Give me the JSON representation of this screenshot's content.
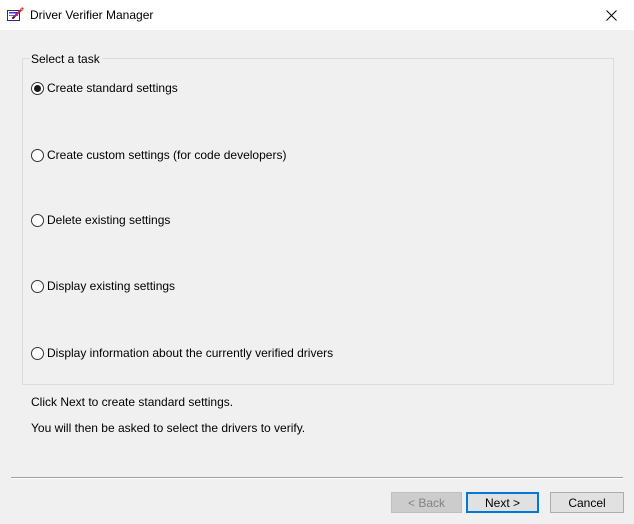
{
  "window": {
    "title": "Driver Verifier Manager",
    "app_icon": "driver-verifier-app-icon",
    "close_icon": "close-icon"
  },
  "task_group": {
    "legend": "Select a task",
    "options": [
      {
        "label": "Create standard settings",
        "checked": true
      },
      {
        "label": "Create custom settings (for code developers)",
        "checked": false
      },
      {
        "label": "Delete existing settings",
        "checked": false
      },
      {
        "label": "Display existing settings",
        "checked": false
      },
      {
        "label": "Display information about the currently verified drivers",
        "checked": false
      }
    ]
  },
  "info": {
    "line1": "Click Next to create standard settings.",
    "line2": "You will then be asked to select the drivers to verify."
  },
  "buttons": {
    "back": "< Back",
    "next": "Next >",
    "cancel": "Cancel"
  },
  "colors": {
    "dialog_background": "#f0f0f0",
    "titlebar_background": "#ffffff",
    "focus_border": "#0078d7",
    "disabled_text": "#838383"
  }
}
